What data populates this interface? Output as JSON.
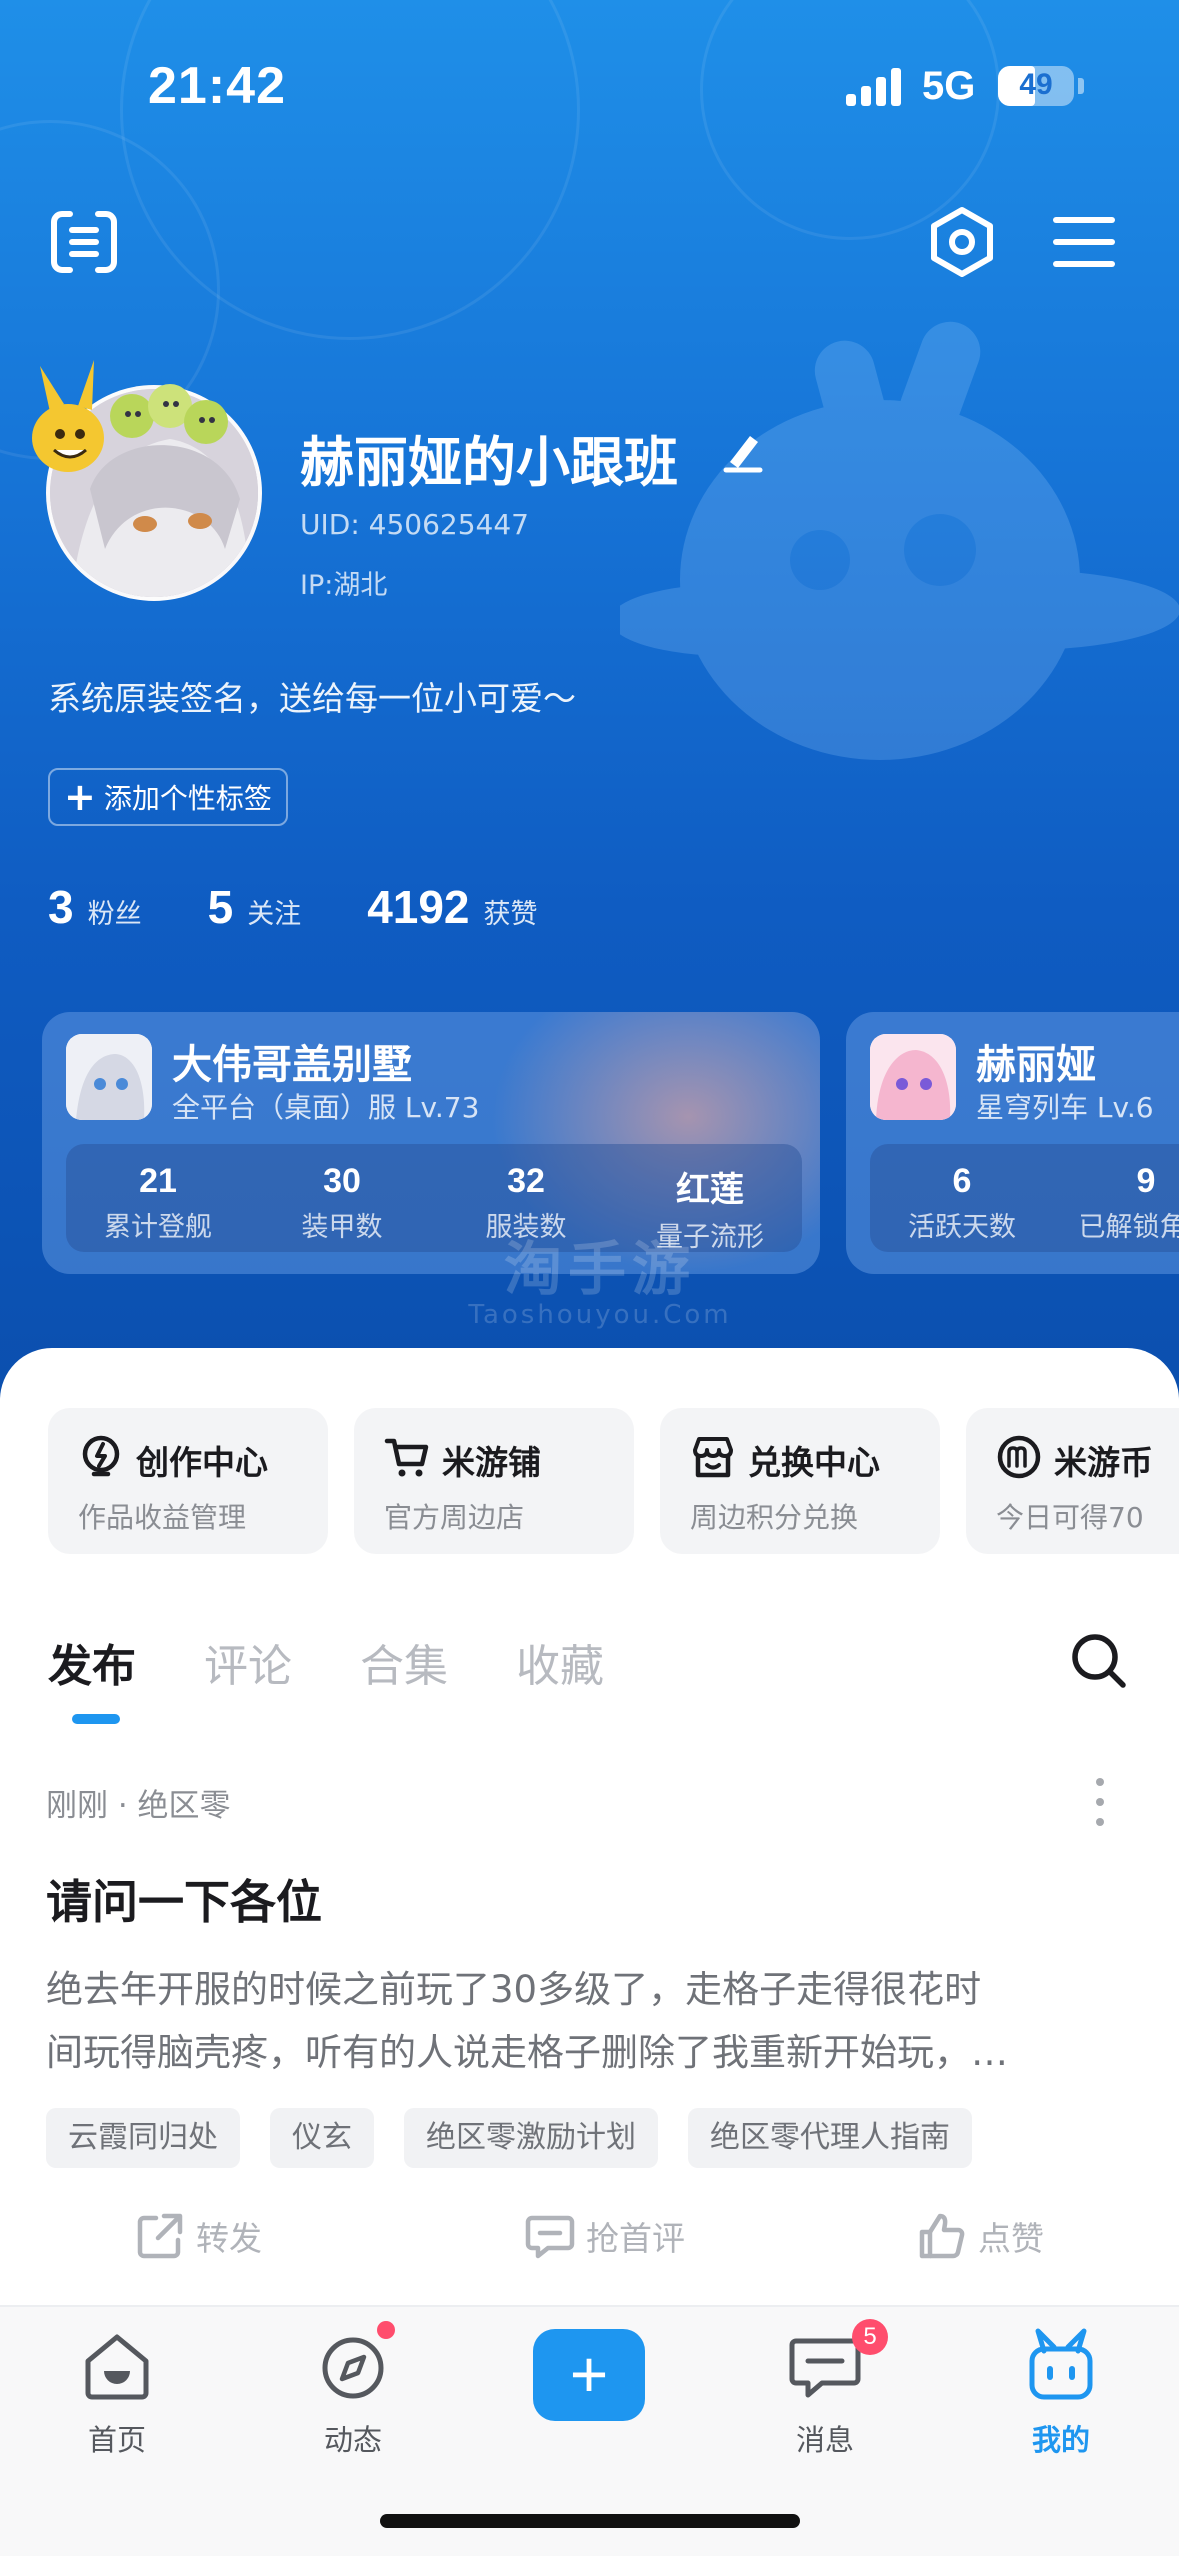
{
  "status": {
    "time": "21:42",
    "network": "5G",
    "battery": "49",
    "battery_level": 0.49
  },
  "profile": {
    "nickname": "赫丽娅的小跟班",
    "uid": "UID: 450625447",
    "ip": "IP:湖北",
    "signature": "系统原装签名，送给每一位小可爱～",
    "add_tag_label": "添加个性标签",
    "stats": [
      {
        "value": "3",
        "label": "粉丝"
      },
      {
        "value": "5",
        "label": "关注"
      },
      {
        "value": "4192",
        "label": "获赞"
      }
    ]
  },
  "game_cards": [
    {
      "name": "大伟哥盖别墅",
      "server": "全平台（桌面）服 Lv.73",
      "stats": [
        {
          "value": "21",
          "label": "累计登舰"
        },
        {
          "value": "30",
          "label": "装甲数"
        },
        {
          "value": "32",
          "label": "服装数"
        },
        {
          "value": "红莲",
          "label": "量子流形"
        }
      ]
    },
    {
      "name": "赫丽娅",
      "server": "星穹列车 Lv.6",
      "stats": [
        {
          "value": "6",
          "label": "活跃天数"
        },
        {
          "value": "9",
          "label": "已解锁角色"
        }
      ]
    }
  ],
  "watermark": {
    "big": "淘手游",
    "small": "Taoshouyou.Com"
  },
  "services": [
    {
      "title": "创作中心",
      "desc": "作品收益管理",
      "icon": "bulb-icon"
    },
    {
      "title": "米游铺",
      "desc": "官方周边店",
      "icon": "cart-icon"
    },
    {
      "title": "兑换中心",
      "desc": "周边积分兑换",
      "icon": "shop-icon"
    },
    {
      "title": "米游币",
      "desc": "今日可得70",
      "icon": "coin-icon"
    }
  ],
  "tabs": [
    "发布",
    "评论",
    "合集",
    "收藏"
  ],
  "post": {
    "meta": "刚刚 · 绝区零",
    "title": "请问一下各位",
    "body_line1": "绝去年开服的时候之前玩了30多级了，走格子走得很花时",
    "body_line2": "间玩得脑壳疼，听有的人说走格子删除了我重新开始玩，…",
    "tags": [
      "云霞同归处",
      "仪玄",
      "绝区零激励计划",
      "绝区零代理人指南"
    ],
    "actions": {
      "share": "转发",
      "comment": "抢首评",
      "like": "点赞"
    }
  },
  "tabbar": {
    "home": "首页",
    "feed": "动态",
    "publish": "+",
    "messages": "消息",
    "messages_badge": "5",
    "me": "我的"
  },
  "colors": {
    "accent": "#1e96f0",
    "hero_top": "#1f8fe8",
    "hero_bottom": "#0b4fae",
    "badge": "#ff4d6d"
  }
}
